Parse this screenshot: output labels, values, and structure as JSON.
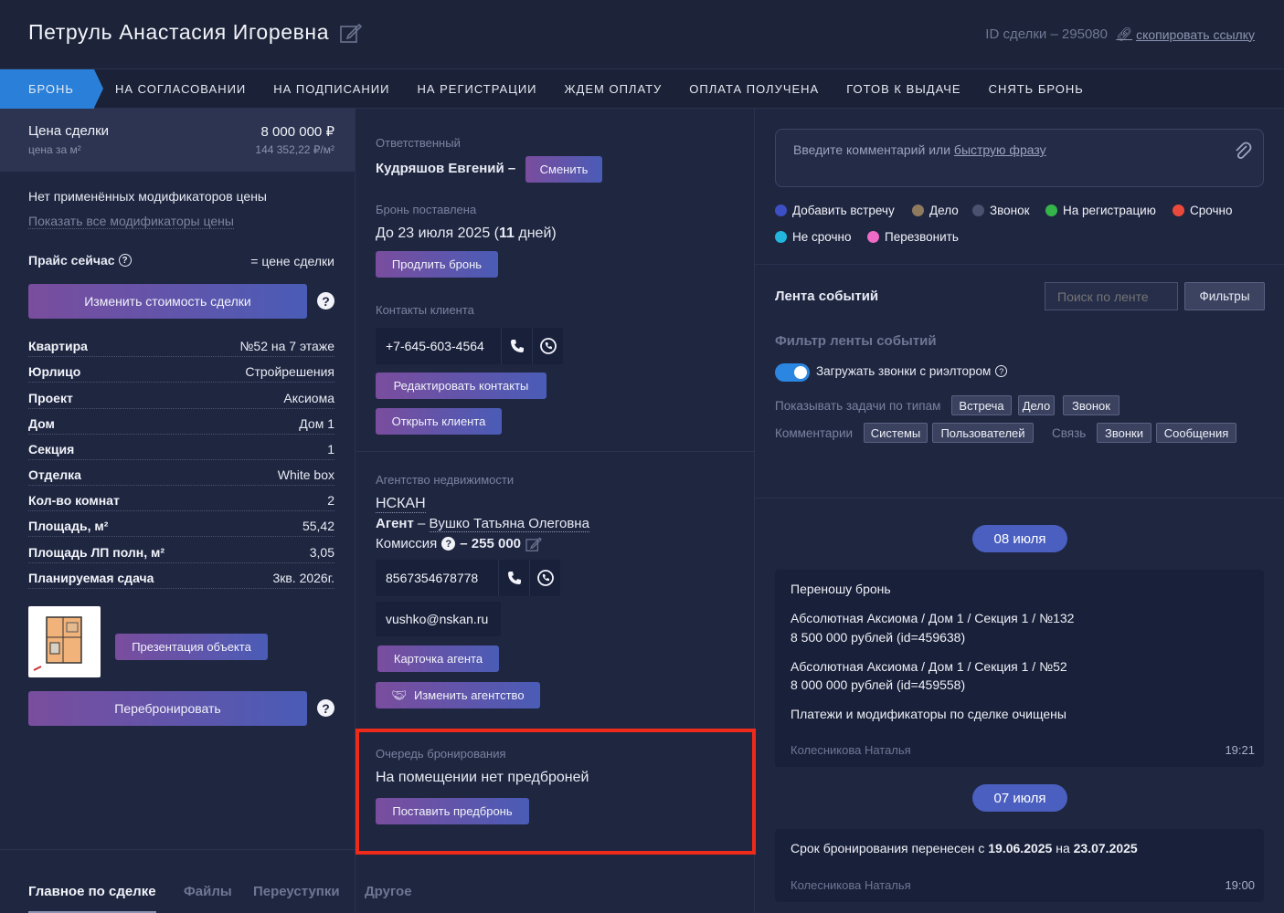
{
  "header": {
    "client_name": "Петруль Анастасия Игоревна",
    "deal_id": "ID сделки – 295080",
    "copy_link": "скопировать ссылку"
  },
  "tabs": [
    "БРОНЬ",
    "НА СОГЛАСОВАНИИ",
    "НА ПОДПИСАНИИ",
    "НА РЕГИСТРАЦИИ",
    "ЖДЕМ ОПЛАТУ",
    "ОПЛАТА ПОЛУЧЕНА",
    "ГОТОВ К ВЫДАЧЕ",
    "СНЯТЬ БРОНЬ"
  ],
  "left": {
    "price_label": "Цена сделки",
    "price_value": "8 000 000 ₽",
    "per_m2_label": "цена за м²",
    "per_m2_value": "144 352,22 ₽/м²",
    "no_modifiers": "Нет применённых модификаторов цены",
    "show_modifiers": "Показать все модификаторы цены",
    "price_now_label": "Прайс сейчас",
    "price_now_value": "= цене сделки",
    "change_price_btn": "Изменить стоимость сделки",
    "props": [
      {
        "k": "Квартира",
        "v": "№52 на 7 этаже"
      },
      {
        "k": "Юрлицо",
        "v": "Стройрешения"
      },
      {
        "k": "Проект",
        "v": "Аксиома"
      },
      {
        "k": "Дом",
        "v": "Дом 1"
      },
      {
        "k": "Секция",
        "v": "1"
      },
      {
        "k": "Отделка",
        "v": "White box"
      },
      {
        "k": "Кол-во комнат",
        "v": "2"
      },
      {
        "k": "Площадь, м²",
        "v": "55,42"
      },
      {
        "k": "Площадь ЛП полн, м²",
        "v": "3,05"
      },
      {
        "k": "Планируемая сдача",
        "v": "3кв. 2026г."
      }
    ],
    "presentation_btn": "Презентация объекта",
    "rebook_btn": "Перебронировать",
    "bottom_tabs": [
      "Главное по сделке",
      "Файлы",
      "Переуступки",
      "Другое"
    ]
  },
  "middle": {
    "responsible_label": "Ответственный",
    "responsible_name": "Кудряшов Евгений –",
    "change_btn": "Сменить",
    "booking_label": "Бронь поставлена",
    "booking_until": "До 23 июля 2025 (",
    "booking_days": "11",
    "booking_days_suffix": " дней)",
    "extend_btn": "Продлить бронь",
    "contacts_label": "Контакты клиента",
    "client_phone": "+7-645-603-4564",
    "edit_contacts_btn": "Редактировать контакты",
    "open_client_btn": "Открыть клиента",
    "agency_label": "Агентство недвижимости",
    "agency_name": "НСКАН",
    "agent_prefix": "Агент",
    "agent_name": "Вушко Татьяна Олеговна",
    "commission_label": "Комиссия",
    "commission_value": "– 255 000",
    "agent_phone": "8567354678778",
    "agent_email": "vushko@nskan.ru",
    "agent_card_btn": "Карточка агента",
    "change_agency_btn": "Изменить агентство",
    "queue_label": "Очередь бронирования",
    "queue_text": "На помещении нет предброней",
    "prebook_btn": "Поставить предбронь"
  },
  "right": {
    "comment_placeholder": "Введите комментарий или ",
    "quick_phrase": "быструю фразу",
    "legend": [
      {
        "label": "Добавить встречу",
        "color": "#3d4fc4"
      },
      {
        "label": "Дело",
        "color": "#8f7a5e"
      },
      {
        "label": "Звонок",
        "color": "#4a5270"
      },
      {
        "label": "На регистрацию",
        "color": "#35b44a"
      },
      {
        "label": "Срочно",
        "color": "#ea4a3c"
      },
      {
        "label": "Не срочно",
        "color": "#22b6de"
      },
      {
        "label": "Перезвонить",
        "color": "#f06ac8"
      }
    ],
    "feed_title": "Лента событий",
    "feed_search_placeholder": "Поиск по ленте",
    "filters_btn": "Фильтры",
    "filter_title": "Фильтр ленты событий",
    "toggle_label": "Загружать звонки с риэлтором",
    "show_tasks_label": "Показывать задачи по типам",
    "task_chips": [
      "Встреча",
      "Дело",
      "Звонок"
    ],
    "comments_label": "Комментарии",
    "comment_chips": [
      "Системы",
      "Пользователей"
    ],
    "link_label": "Связь",
    "link_chips": [
      "Звонки",
      "Сообщения"
    ],
    "events": [
      {
        "date": "08 июля",
        "lines": [
          "Переношу бронь",
          "Абсолютная Аксиома / Дом 1 / Секция 1 / №132",
          "8 500 000 рублей (id=459638)",
          "Абсолютная Аксиома / Дом 1 / Секция 1 / №52",
          "8 000 000 рублей (id=459558)",
          "Платежи и модификаторы по сделке очищены"
        ],
        "author": "Колесникова Наталья",
        "time": "19:21"
      },
      {
        "date": "07 июля",
        "text_prefix": "Срок бронирования перенесен с ",
        "from": "19.06.2025",
        "mid": " на ",
        "to": "23.07.2025",
        "author": "Колесникова Наталья",
        "time": "19:00"
      }
    ]
  }
}
